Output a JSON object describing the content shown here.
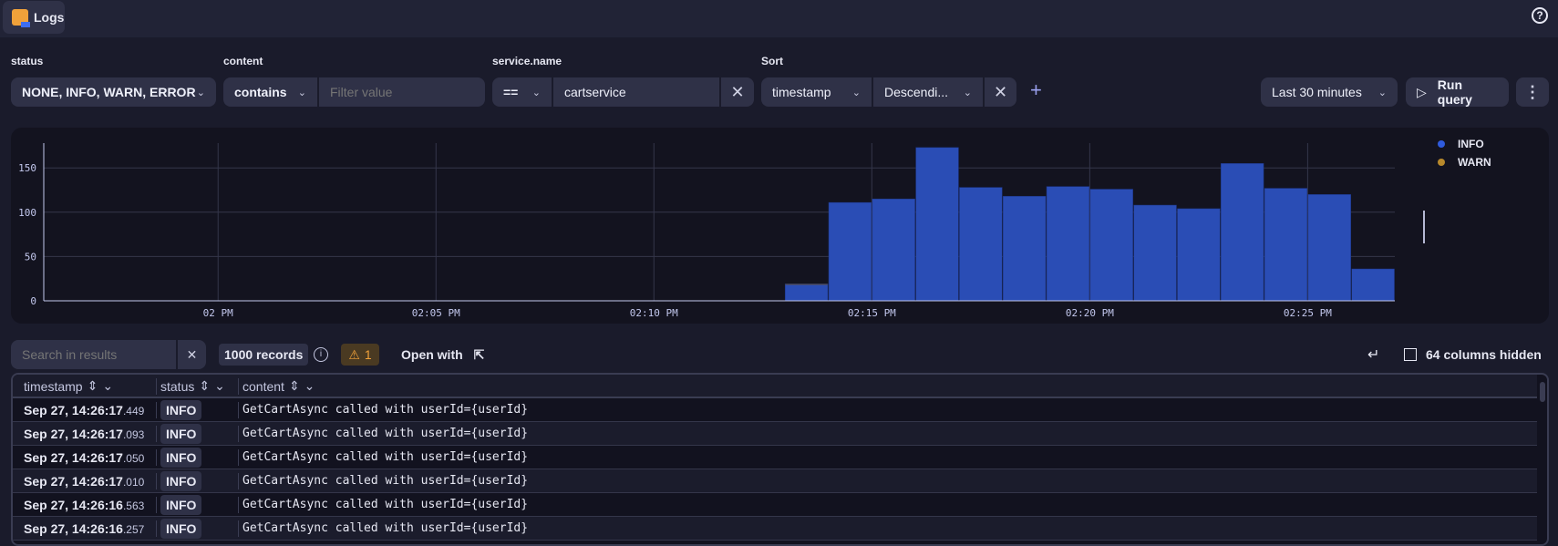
{
  "app": {
    "title": "Logs",
    "help_icon": "question-circle-icon"
  },
  "filters": {
    "status": {
      "label": "status",
      "value": "NONE, INFO, WARN, ERROR"
    },
    "content": {
      "label": "content",
      "operator": "contains",
      "placeholder": "Filter value"
    },
    "service": {
      "label": "service.name",
      "operator": "==",
      "value": "cartservice"
    },
    "sort": {
      "label": "Sort",
      "field": "timestamp",
      "direction": "Descendi..."
    },
    "timeframe": "Last 30 minutes",
    "run_label": "Run query"
  },
  "chart_data": {
    "type": "bar",
    "stacked": true,
    "x_ticks": [
      "02 PM",
      "02:05 PM",
      "02:10 PM",
      "02:15 PM",
      "02:20 PM",
      "02:25 PM"
    ],
    "y_ticks": [
      "0",
      "50",
      "100",
      "150"
    ],
    "xlim": [
      "13:56",
      "14:27"
    ],
    "ylim": [
      0,
      178
    ],
    "grid": true,
    "legend": "right",
    "categories": [
      "14:13",
      "14:14",
      "14:15",
      "14:16",
      "14:17",
      "14:18",
      "14:19",
      "14:20",
      "14:21",
      "14:22",
      "14:23",
      "14:24",
      "14:25",
      "14:26"
    ],
    "series": [
      {
        "name": "INFO",
        "color": "#2a4db5",
        "values": [
          18,
          111,
          115,
          173,
          128,
          118,
          129,
          126,
          108,
          104,
          155,
          127,
          120,
          36
        ]
      },
      {
        "name": "WARN",
        "color": "#b8892c",
        "values": [
          1,
          0,
          0,
          0,
          0,
          0,
          0,
          0,
          0,
          0,
          0,
          0,
          0,
          0
        ]
      }
    ]
  },
  "results": {
    "search_placeholder": "Search in results",
    "records": "1000 records",
    "warnings": "1",
    "open_with": "Open with",
    "columns_hidden": "64 columns hidden",
    "columns": [
      "timestamp",
      "status",
      "content"
    ],
    "rows": [
      {
        "ts": "Sep 27, 14:26:17",
        "ms": ".449",
        "status": "INFO",
        "content": "GetCartAsync called with userId={userId}"
      },
      {
        "ts": "Sep 27, 14:26:17",
        "ms": ".093",
        "status": "INFO",
        "content": "GetCartAsync called with userId={userId}"
      },
      {
        "ts": "Sep 27, 14:26:17",
        "ms": ".050",
        "status": "INFO",
        "content": "GetCartAsync called with userId={userId}"
      },
      {
        "ts": "Sep 27, 14:26:17",
        "ms": ".010",
        "status": "INFO",
        "content": "GetCartAsync called with userId={userId}"
      },
      {
        "ts": "Sep 27, 14:26:16",
        "ms": ".563",
        "status": "INFO",
        "content": "GetCartAsync called with userId={userId}"
      },
      {
        "ts": "Sep 27, 14:26:16",
        "ms": ".257",
        "status": "INFO",
        "content": "GetCartAsync called with userId={userId}"
      }
    ]
  }
}
